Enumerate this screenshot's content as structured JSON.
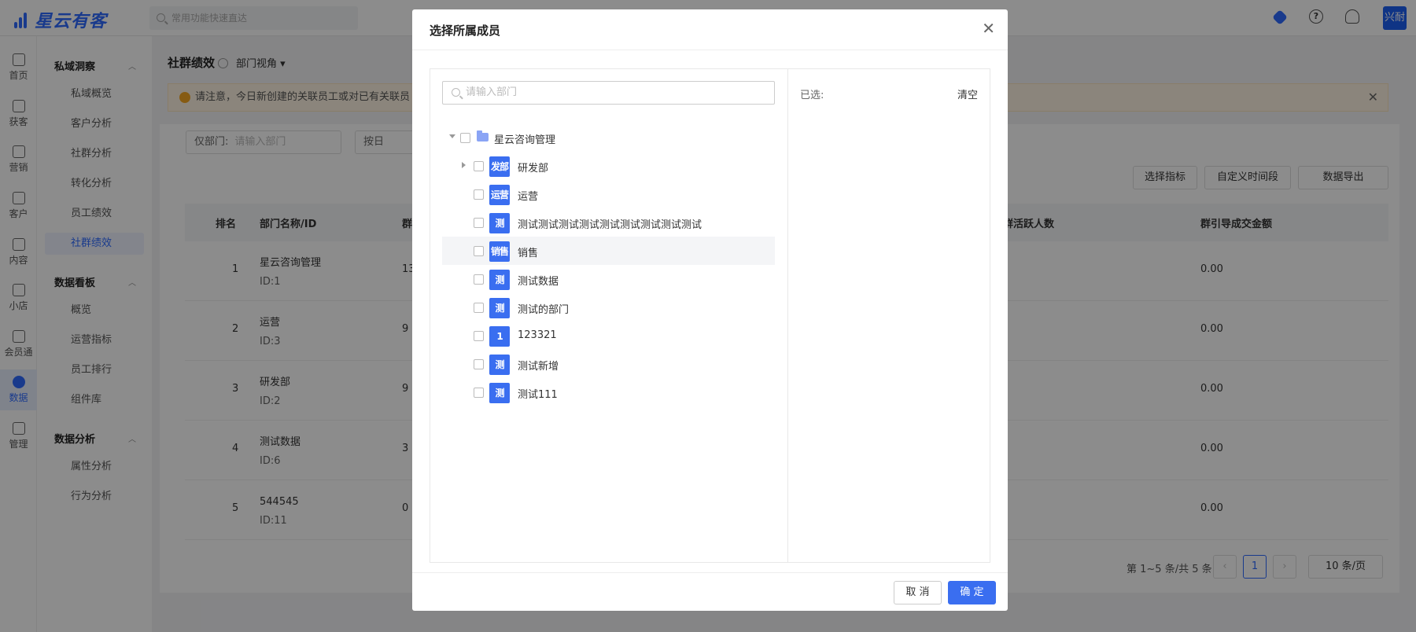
{
  "brand": {
    "name": "星云有客"
  },
  "header": {
    "search_placeholder": "常用功能快速直达",
    "avatar_label": "兴耐",
    "icons": [
      "badge-icon",
      "help-icon",
      "headset-icon"
    ]
  },
  "rail": [
    {
      "label": "首页",
      "icon": "home-icon"
    },
    {
      "label": "获客",
      "icon": "user-icon"
    },
    {
      "label": "营销",
      "icon": "bulb-icon"
    },
    {
      "label": "客户",
      "icon": "customer-icon"
    },
    {
      "label": "内容",
      "icon": "folder-icon"
    },
    {
      "label": "小店",
      "icon": "shop-icon"
    },
    {
      "label": "会员通",
      "icon": "member-icon"
    },
    {
      "label": "数据",
      "icon": "chart-icon",
      "active": true
    },
    {
      "label": "管理",
      "icon": "grid-icon"
    }
  ],
  "side": {
    "groups": [
      {
        "title": "私域洞察",
        "items": [
          "私域概览",
          "客户分析",
          "社群分析",
          "转化分析",
          "员工绩效",
          "社群绩效"
        ]
      },
      {
        "title": "数据看板",
        "items": [
          "概览",
          "运营指标",
          "员工排行",
          "组件库"
        ]
      },
      {
        "title": "数据分析",
        "items": [
          "属性分析",
          "行为分析"
        ]
      }
    ],
    "active_item": "社群绩效"
  },
  "main": {
    "title": "社群绩效",
    "view_label": "部门视角 ▾",
    "notice": "请注意，今日新创建的关联员工或对已有关联员",
    "filter_dept_label": "仅部门:",
    "filter_dept_placeholder": "请输入部门",
    "filter_period": "按日",
    "buttons": [
      "选择指标",
      "自定义时间段",
      "数据导出"
    ],
    "columns": [
      "排名",
      "部门名称/ID",
      "群",
      "群活跃人数",
      "群引导成交金额"
    ],
    "rows": [
      {
        "rank": "1",
        "name": "星云咨询管理",
        "id": "ID:1",
        "count": "13",
        "amount": "0.00"
      },
      {
        "rank": "2",
        "name": "运营",
        "id": "ID:3",
        "count": "9",
        "amount": "0.00"
      },
      {
        "rank": "3",
        "name": "研发部",
        "id": "ID:2",
        "count": "9",
        "amount": "0.00"
      },
      {
        "rank": "4",
        "name": "测试数据",
        "id": "ID:6",
        "count": "3",
        "amount": "0.00"
      },
      {
        "rank": "5",
        "name": "544545",
        "id": "ID:11",
        "count": "0",
        "amount": "0.00"
      }
    ],
    "pagination": {
      "summary": "第 1~5 条/共 5 条",
      "current_page": "1",
      "page_size": "10 条/页"
    }
  },
  "modal": {
    "title": "选择所属成员",
    "search_placeholder": "请输入部门",
    "root": "星云咨询管理",
    "departments": [
      {
        "icon_text": "发部",
        "name": "研发部",
        "expandable": true
      },
      {
        "icon_text": "运营",
        "name": "运营"
      },
      {
        "icon_text": "测",
        "name": "测试测试测试测试测试测试测试测试测试"
      },
      {
        "icon_text": "销售",
        "name": "销售"
      },
      {
        "icon_text": "测",
        "name": "测试数据"
      },
      {
        "icon_text": "测",
        "name": "测试的部门"
      },
      {
        "icon_text": "1",
        "name": "123321"
      },
      {
        "icon_text": "测",
        "name": "测试新增"
      },
      {
        "icon_text": "测",
        "name": "测试111"
      }
    ],
    "selected_label": "已选:",
    "clear_label": "清空",
    "cancel_label": "取 消",
    "ok_label": "确 定",
    "close_icon": "close-icon"
  },
  "colors": {
    "primary": "#2f6bff",
    "dept_icon": "#3a6ef0",
    "notice_bg": "#fdf3e2"
  }
}
